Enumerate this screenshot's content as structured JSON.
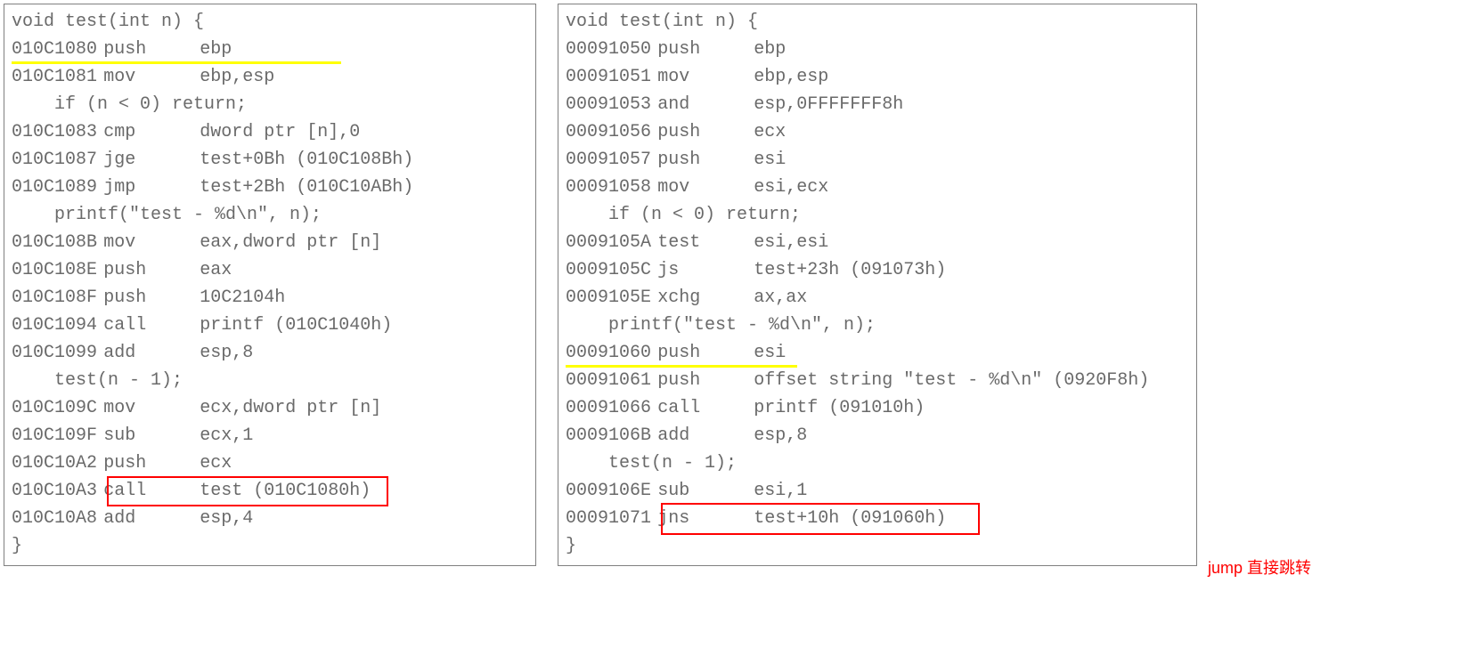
{
  "left": {
    "src0": "void test(int n) {",
    "l1": {
      "addr": "010C1080",
      "mn": "push",
      "opr": "ebp"
    },
    "l2": {
      "addr": "010C1081",
      "mn": "mov",
      "opr": "ebp,esp"
    },
    "src1": "if (n < 0) return;",
    "l3": {
      "addr": "010C1083",
      "mn": "cmp",
      "opr": "dword ptr [n],0"
    },
    "l4": {
      "addr": "010C1087",
      "mn": "jge",
      "opr": "test+0Bh (010C108Bh)"
    },
    "l5": {
      "addr": "010C1089",
      "mn": "jmp",
      "opr": "test+2Bh (010C10ABh)"
    },
    "src2": "printf(\"test - %d\\n\", n);",
    "l6": {
      "addr": "010C108B",
      "mn": "mov",
      "opr": "eax,dword ptr [n]"
    },
    "l7": {
      "addr": "010C108E",
      "mn": "push",
      "opr": "eax"
    },
    "l8": {
      "addr": "010C108F",
      "mn": "push",
      "opr": "10C2104h"
    },
    "l9": {
      "addr": "010C1094",
      "mn": "call",
      "opr": "printf (010C1040h)"
    },
    "l10": {
      "addr": "010C1099",
      "mn": "add",
      "opr": "esp,8"
    },
    "src3": "test(n - 1);",
    "l11": {
      "addr": "010C109C",
      "mn": "mov",
      "opr": "ecx,dword ptr [n]"
    },
    "l12": {
      "addr": "010C109F",
      "mn": "sub",
      "opr": "ecx,1"
    },
    "l13": {
      "addr": "010C10A2",
      "mn": "push",
      "opr": "ecx"
    },
    "l14": {
      "addr": "010C10A3",
      "mn": "call",
      "opr": "test (010C1080h)"
    },
    "l15": {
      "addr": "010C10A8",
      "mn": "add",
      "opr": "esp,4"
    },
    "srcend": "}"
  },
  "right": {
    "src0": "void test(int n) {",
    "r1": {
      "addr": "00091050",
      "mn": "push",
      "opr": "ebp"
    },
    "r2": {
      "addr": "00091051",
      "mn": "mov",
      "opr": "ebp,esp"
    },
    "r3": {
      "addr": "00091053",
      "mn": "and",
      "opr": "esp,0FFFFFFF8h"
    },
    "r4": {
      "addr": "00091056",
      "mn": "push",
      "opr": "ecx"
    },
    "r5": {
      "addr": "00091057",
      "mn": "push",
      "opr": "esi"
    },
    "r6": {
      "addr": "00091058",
      "mn": "mov",
      "opr": "esi,ecx"
    },
    "src1": "if (n < 0) return;",
    "r7": {
      "addr": "0009105A",
      "mn": "test",
      "opr": "esi,esi"
    },
    "r8": {
      "addr": "0009105C",
      "mn": "js",
      "opr": "test+23h (091073h)"
    },
    "r9": {
      "addr": "0009105E",
      "mn": "xchg",
      "opr": "ax,ax"
    },
    "src2": "printf(\"test - %d\\n\", n);",
    "r10": {
      "addr": "00091060",
      "mn": "push",
      "opr": "esi"
    },
    "r11": {
      "addr": "00091061",
      "mn": "push",
      "opr": "offset string \"test - %d\\n\" (0920F8h)"
    },
    "r12": {
      "addr": "00091066",
      "mn": "call",
      "opr": "printf (091010h)"
    },
    "r13": {
      "addr": "0009106B",
      "mn": "add",
      "opr": "esp,8"
    },
    "src3": "test(n - 1);",
    "r14": {
      "addr": "0009106E",
      "mn": "sub",
      "opr": "esi,1"
    },
    "r15": {
      "addr": "00091071",
      "mn": "jns",
      "opr": "test+10h (091060h)"
    },
    "srcend": "}",
    "annotation": "jump 直接跳转"
  }
}
